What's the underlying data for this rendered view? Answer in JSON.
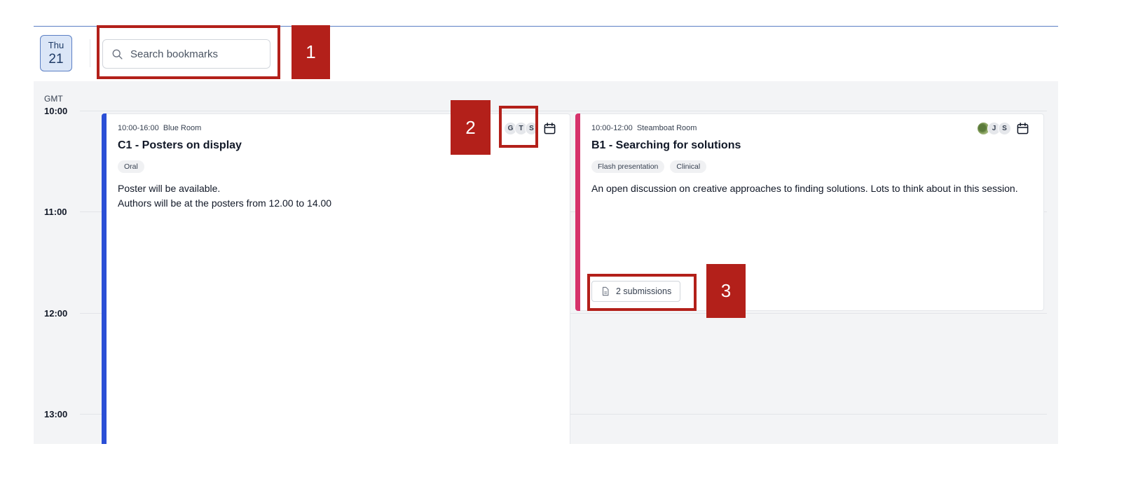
{
  "date_chip": {
    "weekday": "Thu",
    "day": "21"
  },
  "search": {
    "placeholder": "Search bookmarks",
    "value": ""
  },
  "timezone": "GMT",
  "time_slots": [
    "10:00",
    "11:00",
    "12:00",
    "13:00"
  ],
  "events": [
    {
      "time": "10:00-16:00",
      "room": "Blue Room",
      "title": "C1 - Posters on display",
      "tags": [
        "Oral"
      ],
      "description": [
        "Poster will be available.",
        "Authors will be at the posters from 12.00 to 14.00"
      ],
      "avatars": [
        "G",
        "T",
        "S"
      ],
      "accent": "#2b4fd6"
    },
    {
      "time": "10:00-12:00",
      "room": "Steamboat Room",
      "title": "B1 - Searching for solutions",
      "tags": [
        "Flash presentation",
        "Clinical"
      ],
      "description": [
        "An open discussion on creative approaches to finding solutions. Lots to think about in this session."
      ],
      "avatars": [
        "",
        "J",
        "S"
      ],
      "submissions_label": "2 submissions",
      "accent": "#d6336c"
    }
  ],
  "annotations": [
    "1",
    "2",
    "3"
  ],
  "colors": {
    "highlight": "#b3201a",
    "chip_border": "#5b7fc4"
  },
  "icons": {
    "search": "search-icon",
    "calendar": "calendar-icon",
    "document": "document-icon"
  }
}
